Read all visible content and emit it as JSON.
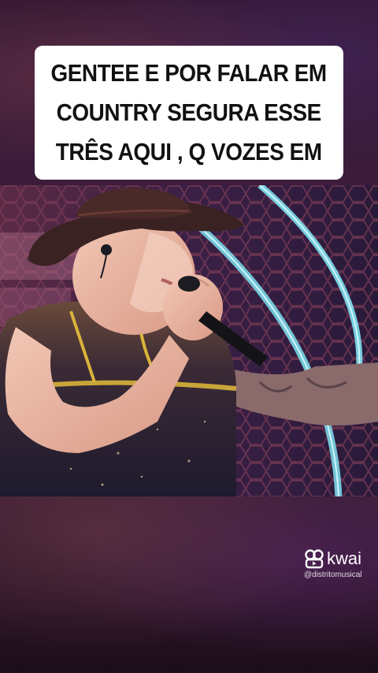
{
  "caption": {
    "lines": [
      "GENTEE E POR FALAR EM",
      "COUNTRY SEGURA ESSE",
      "TRÊS AQUI , Q VOZES EM"
    ]
  },
  "video": {
    "icons": [
      "cowboy-hat",
      "microphone",
      "earpiece"
    ]
  },
  "watermark": {
    "brand": "kwai",
    "handle": "@distritomusical",
    "icon": "kwai-logo-icon"
  },
  "colors": {
    "caption_bg": "#ffffff",
    "caption_text": "#111111",
    "stage_neon": "#7ee0f0",
    "background": "#2c1430"
  }
}
